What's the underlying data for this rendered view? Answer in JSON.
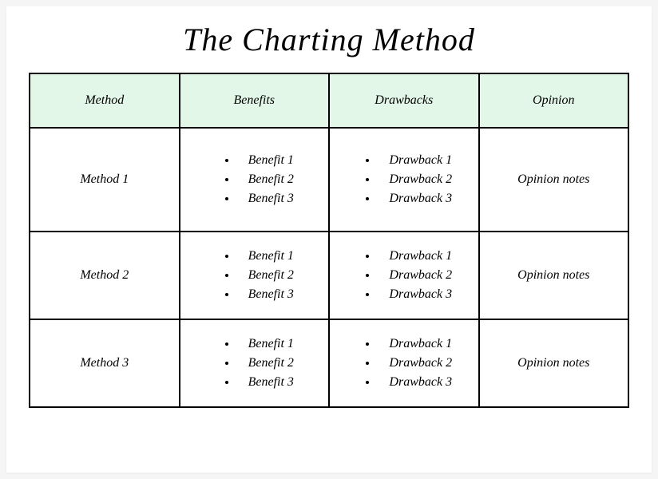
{
  "title": "The Charting Method",
  "headers": [
    "Method",
    "Benefits",
    "Drawbacks",
    "Opinion"
  ],
  "rows": [
    {
      "method": "Method 1",
      "benefits": [
        "Benefit 1",
        "Benefit 2",
        "Benefit 3"
      ],
      "drawbacks": [
        "Drawback 1",
        "Drawback 2",
        "Drawback 3"
      ],
      "opinion": "Opinion notes"
    },
    {
      "method": "Method 2",
      "benefits": [
        "Benefit 1",
        "Benefit 2",
        "Benefit 3"
      ],
      "drawbacks": [
        "Drawback 1",
        "Drawback 2",
        "Drawback 3"
      ],
      "opinion": "Opinion notes"
    },
    {
      "method": "Method 3",
      "benefits": [
        "Benefit 1",
        "Benefit 2",
        "Benefit 3"
      ],
      "drawbacks": [
        "Drawback 1",
        "Drawback 2",
        "Drawback 3"
      ],
      "opinion": "Opinion notes"
    }
  ]
}
